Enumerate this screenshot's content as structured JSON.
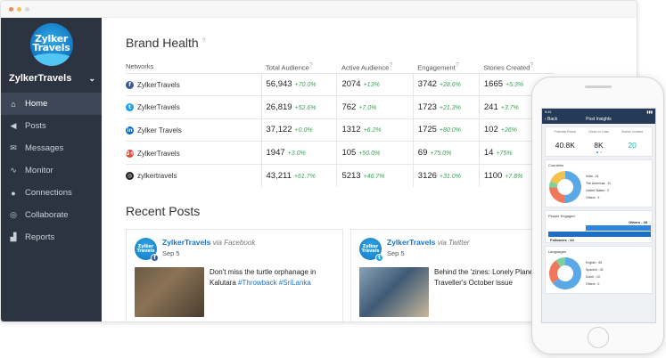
{
  "sidebar": {
    "logo_text_line1": "Zylker",
    "logo_text_line2": "Travels",
    "brand": "ZylkerTravels",
    "items": [
      {
        "label": "Home",
        "icon": "home-icon",
        "glyph": "⌂",
        "active": true
      },
      {
        "label": "Posts",
        "icon": "megaphone-icon",
        "glyph": "◀",
        "active": false
      },
      {
        "label": "Messages",
        "icon": "envelope-icon",
        "glyph": "✉",
        "active": false
      },
      {
        "label": "Monitor",
        "icon": "pulse-icon",
        "glyph": "∿",
        "active": false
      },
      {
        "label": "Connections",
        "icon": "people-icon",
        "glyph": "●",
        "active": false
      },
      {
        "label": "Collaborate",
        "icon": "chat-icon",
        "glyph": "◎",
        "active": false
      },
      {
        "label": "Reports",
        "icon": "chart-icon",
        "glyph": "▟",
        "active": false
      }
    ]
  },
  "brand_health": {
    "title": "Brand Health",
    "columns": [
      "Networks",
      "Total Audience",
      "Active Audience",
      "Engagement",
      "Stories Created"
    ],
    "rows": [
      {
        "network": "ZylkerTravels",
        "icon": "facebook-icon",
        "color": "#3b5998",
        "glyph": "f",
        "total": "56,943",
        "total_delta": "+70.0%",
        "active": "2074",
        "active_delta": "+13%",
        "engagement": "3742",
        "engagement_delta": "+28.6%",
        "stories": "1665",
        "stories_delta": "+5.3%"
      },
      {
        "network": "ZylkerTravels",
        "icon": "twitter-icon",
        "color": "#1da1f2",
        "glyph": "t",
        "total": "26,819",
        "total_delta": "+52.6%",
        "active": "762",
        "active_delta": "+7.0%",
        "engagement": "1723",
        "engagement_delta": "+21.3%",
        "stories": "241",
        "stories_delta": "+3.7%"
      },
      {
        "network": "Zylker Travels",
        "icon": "linkedin-icon",
        "color": "#0a66c2",
        "glyph": "in",
        "total": "37,122",
        "total_delta": "+0.0%",
        "active": "1312",
        "active_delta": "+6.2%",
        "engagement": "1725",
        "engagement_delta": "+80.0%",
        "stories": "102",
        "stories_delta": "+26%"
      },
      {
        "network": "ZylkerTravels",
        "icon": "googleplus-icon",
        "color": "#dd4b39",
        "glyph": "G+",
        "total": "1947",
        "total_delta": "+3.0%",
        "active": "105",
        "active_delta": "+50.0%",
        "engagement": "69",
        "engagement_delta": "+75.0%",
        "stories": "14",
        "stories_delta": "+75%"
      },
      {
        "network": "zylkertravels",
        "icon": "instagram-icon",
        "color": "#222222",
        "glyph": "◎",
        "total": "43,211",
        "total_delta": "+61.7%",
        "active": "5213",
        "active_delta": "+46.7%",
        "engagement": "3126",
        "engagement_delta": "+31.0%",
        "stories": "1100",
        "stories_delta": "+7.8%"
      }
    ]
  },
  "recent_posts": {
    "title": "Recent Posts",
    "posts": [
      {
        "author": "ZylkerTravels",
        "via": "via Facebook",
        "date": "Sep 5",
        "badge_color": "#3b5998",
        "badge_glyph": "f",
        "text": "Don't miss the turtle orphanage in Kalutara ",
        "tags": "#Throwback #SriLanka"
      },
      {
        "author": "ZylkerTravels",
        "via": "via Twitter",
        "date": "Sep 5",
        "badge_color": "#1da1f2",
        "badge_glyph": "t",
        "text": "Behind the 'zines: Lonely Planet Traveller's October issue",
        "tags": ""
      }
    ]
  },
  "phone": {
    "status_time": "9:41",
    "back_label": "‹ Back",
    "title": "Post Insights",
    "stats": [
      {
        "label": "Potential Reach",
        "value": "40.8K"
      },
      {
        "label": "Clicks on Links",
        "value": "8K"
      },
      {
        "label": "Stories Created",
        "value": "20"
      }
    ],
    "countries": {
      "title": "Countries",
      "items": [
        {
          "label": "India : 24",
          "value": 24,
          "color": "#5aa9e6"
        },
        {
          "label": "The Americas : 11",
          "value": 11,
          "color": "#f0765c"
        },
        {
          "label": "United States : 3",
          "value": 3,
          "color": "#7fcf9f"
        },
        {
          "label": "Others : 9",
          "value": 9,
          "color": "#f2c14e"
        }
      ]
    },
    "people_engaged": {
      "title": "People Engaged",
      "others_label": "Others - 28",
      "followers_label": "Followers - 44",
      "others": 28,
      "followers": 44
    },
    "languages": {
      "title": "Languages",
      "items": [
        {
          "label": "English : 65",
          "value": 65,
          "color": "#5aa9e6"
        },
        {
          "label": "Spanish : 26",
          "value": 26,
          "color": "#f0765c"
        },
        {
          "label": "Dutch : 10",
          "value": 10,
          "color": "#7fcf9f"
        },
        {
          "label": "Others : 0",
          "value": 0,
          "color": "#f2c14e"
        }
      ]
    }
  }
}
